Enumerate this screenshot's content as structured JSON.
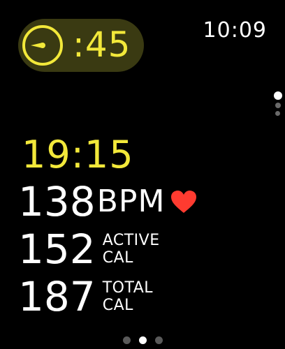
{
  "status_bar": {
    "time": "10:09"
  },
  "timer": {
    "value": ":45",
    "icon": "timer-icon",
    "accent_color": "#f2e83a"
  },
  "workout": {
    "elapsed": "19:15",
    "heart_rate": {
      "value": "138",
      "unit": "BPM",
      "icon": "heart-icon",
      "icon_color": "#ff3b30"
    },
    "active_calories": {
      "value": "152",
      "label_line1": "ACTIVE",
      "label_line2": "CAL"
    },
    "total_calories": {
      "value": "187",
      "label_line1": "TOTAL",
      "label_line2": "CAL"
    }
  },
  "pagination": {
    "vertical": {
      "count": 3,
      "active_index": 0
    },
    "horizontal": {
      "count": 3,
      "active_index": 1
    }
  }
}
